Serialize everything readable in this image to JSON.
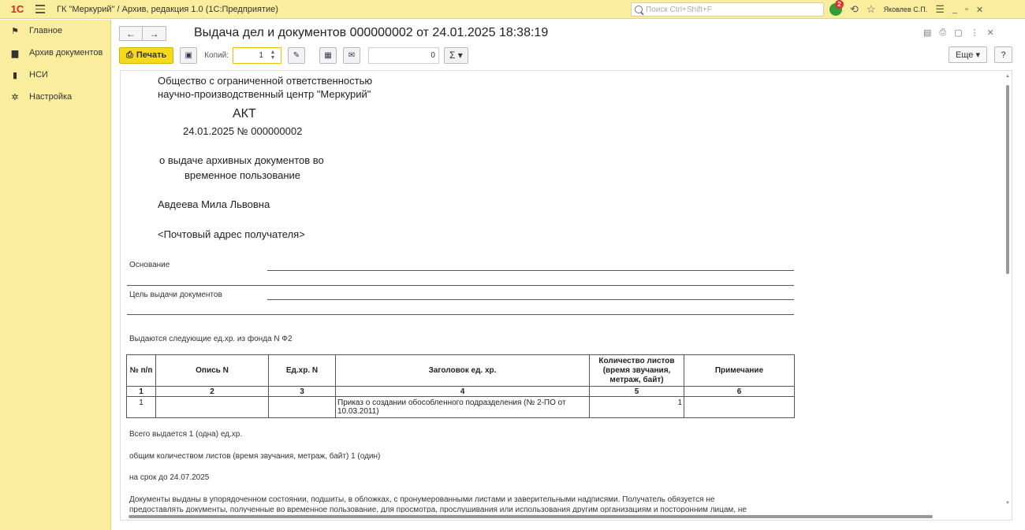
{
  "window": {
    "title": "ГК \"Меркурий\" / Архив, редакция 1.0  (1С:Предприятие)",
    "search_placeholder": "Поиск Ctrl+Shift+F",
    "notification_count": "2",
    "user": "Яковлев С.П."
  },
  "sidebar": {
    "items": [
      {
        "label": "Главное",
        "icon": "flag-icon"
      },
      {
        "label": "Архив документов",
        "icon": "archive-icon"
      },
      {
        "label": "НСИ",
        "icon": "books-icon"
      },
      {
        "label": "Настройка",
        "icon": "gear-icon"
      }
    ]
  },
  "document": {
    "title": "Выдача дел и документов 000000002 от 24.01.2025 18:38:19"
  },
  "toolbar": {
    "print_label": "Печать",
    "copies_label": "Копий:",
    "copies_value": "1",
    "sum_value": "0",
    "sigma_label": "Σ ▾",
    "more_label": "Еще ▾",
    "help_label": "?"
  },
  "report": {
    "org_line1": "Общество с ограниченной ответственностью",
    "org_line2": "научно-производственный центр \"Меркурий\"",
    "act_title": "АКТ",
    "act_number": "24.01.2025 № 000000002",
    "purpose_line1": "о выдаче архивных документов во",
    "purpose_line2": "временное пользование",
    "recipient": "Авдеева Мила Львовна",
    "address": "<Почтовый адрес получателя>",
    "basis_label": "Основание",
    "goal_label": "Цель выдачи документов",
    "fund_text": "Выдаются следующие ед.хр. из фонда N Ф2",
    "table": {
      "headers": [
        "№ п/п",
        "Опись N",
        "Ед.хр. N",
        "Заголовок ед. хр.",
        "Количество листов (время звучания, метраж, байт)",
        "Примечание"
      ],
      "numbers": [
        "1",
        "2",
        "3",
        "4",
        "5",
        "6"
      ],
      "rows": [
        {
          "n": "1",
          "opis": "",
          "ed": "",
          "title": "Приказ о создании обособленного подразделения (№ 2-ПО от 10.03.2011)",
          "qty": "1",
          "note": ""
        }
      ]
    },
    "total_text": "Всего выдается  1 (одна) ед.хр.",
    "sheets_text": "общим количеством листов (время звучания, метраж, байт) 1 (один)",
    "term_text": "на срок до 24.07.2025",
    "final_line1": "Документы выданы в упорядоченном состоянии, подшиты, в обложках, с пронумерованными листами и заверительными надписями. Получатель обязуется не",
    "final_line2": "предоставлять документы, полученные во временное пользование, для просмотра, прослушивания или использования другим организациям и посторонним лицам, не"
  }
}
